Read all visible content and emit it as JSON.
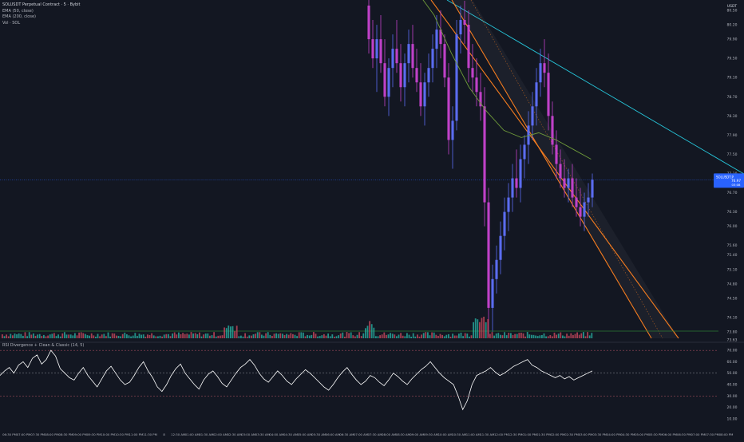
{
  "header": {
    "symbol_title": "SOLUSDT Perpetual Contract · 5 · Bybit",
    "ema50_label": "EMA (50, close)",
    "ema200_label": "EMA (200, close)",
    "vol_label": "Vol · SOL"
  },
  "currency": "USDT",
  "price_badge": {
    "symbol": "SOLUSDT.P",
    "price": "76.97",
    "countdown": "03:08"
  },
  "rsi_label": "RSI Divergence + Clean & Classic (14, 5)",
  "colors": {
    "background": "#131722",
    "bull": "#5b6cf0",
    "bear": "#c041c8",
    "ema50": "#6f9b3a",
    "channel": "#f57c1f",
    "trendline": "#26c6da",
    "rsi_line": "#ffffff",
    "last_price": "#2962ff"
  },
  "chart_data": [
    {
      "type": "candlestick",
      "title": "SOLUSDT Perpetual Contract · 5 · Bybit",
      "y_axis": {
        "unit": "USDT",
        "ticks": [
          "80.50",
          "80.20",
          "79.90",
          "79.50",
          "79.10",
          "78.70",
          "78.30",
          "77.90",
          "77.50",
          "77.10",
          "76.97",
          "76.70",
          "76.30",
          "76.00",
          "75.60",
          "75.40",
          "75.10",
          "74.80",
          "74.50",
          "74.10",
          "73.80",
          "73.63"
        ],
        "range": [
          73.6,
          80.65
        ]
      },
      "x_axis": {
        "ticks": [
          "06:30 PM",
          "07:00 PM",
          "07:30 PM",
          "08:00 PM",
          "08:30 PM",
          "09:00 PM",
          "09:30 PM",
          "10:00 PM",
          "10:30 PM",
          "11:00 PM",
          "11:30 PM",
          "8",
          "12:30 AM",
          "01:00 AM",
          "01:30 AM",
          "02:00 AM",
          "02:30 AM",
          "03:00 AM",
          "03:30 AM",
          "04:00 AM",
          "04:30 AM",
          "05:00 AM",
          "05:30 AM",
          "06:00 AM",
          "06:30 AM",
          "07:00 AM",
          "07:30 AM",
          "08:00 AM",
          "08:30 AM",
          "09:00 AM",
          "09:30 AM",
          "10:00 AM",
          "10:30 AM",
          "11:00 AM",
          "11:30 AM",
          "12:00 PM",
          "12:30 PM",
          "01:00 PM",
          "01:30 PM",
          "02:00 PM",
          "02:30 PM",
          "03:00 PM",
          "03:30 PM",
          "04:00 PM",
          "04:30 PM",
          "05:00 PM",
          "05:30 PM",
          "06:00 PM",
          "06:30 PM",
          "07:00 PM",
          "07:30 PM",
          "08:00 PM"
        ]
      },
      "series": [
        {
          "name": "EMA (50, close)",
          "values": [
            80.9,
            80.4,
            79.6,
            78.9,
            78.4,
            78.0,
            77.85,
            77.95,
            77.8,
            77.6,
            77.4
          ]
        },
        {
          "name": "EMA (200, close)",
          "values": []
        }
      ],
      "ohlc": [
        [
          80.6,
          80.9,
          79.6,
          79.9
        ],
        [
          79.9,
          80.3,
          79.3,
          79.5
        ],
        [
          79.5,
          80.2,
          78.8,
          79.9
        ],
        [
          79.9,
          80.4,
          79.2,
          79.4
        ],
        [
          79.4,
          79.9,
          78.5,
          78.7
        ],
        [
          78.7,
          79.5,
          78.3,
          79.3
        ],
        [
          79.3,
          80.0,
          78.9,
          79.7
        ],
        [
          79.7,
          80.3,
          79.2,
          79.4
        ],
        [
          79.4,
          79.8,
          78.6,
          78.9
        ],
        [
          78.9,
          79.6,
          78.5,
          79.4
        ],
        [
          79.4,
          80.1,
          79.0,
          79.8
        ],
        [
          79.8,
          80.2,
          79.1,
          79.3
        ],
        [
          79.3,
          79.7,
          78.8,
          79.0
        ],
        [
          79.0,
          79.4,
          78.3,
          78.5
        ],
        [
          78.5,
          79.2,
          78.1,
          79.0
        ],
        [
          79.0,
          79.6,
          78.7,
          79.3
        ],
        [
          79.3,
          80.0,
          79.0,
          79.7
        ],
        [
          79.7,
          80.4,
          79.3,
          80.1
        ],
        [
          80.1,
          80.5,
          79.5,
          79.8
        ],
        [
          79.8,
          80.0,
          78.9,
          79.1
        ],
        [
          79.1,
          79.4,
          77.5,
          77.8
        ],
        [
          77.8,
          78.5,
          77.2,
          78.2
        ],
        [
          78.2,
          80.3,
          78.0,
          80.0
        ],
        [
          80.0,
          80.6,
          79.6,
          80.3
        ],
        [
          80.3,
          80.7,
          79.8,
          80.2
        ],
        [
          80.2,
          80.5,
          79.0,
          79.3
        ],
        [
          79.3,
          79.8,
          78.8,
          79.1
        ],
        [
          79.1,
          79.5,
          78.5,
          78.8
        ],
        [
          78.8,
          79.2,
          78.2,
          78.5
        ],
        [
          78.5,
          78.9,
          76.0,
          76.5
        ],
        [
          76.5,
          76.8,
          73.7,
          74.3
        ],
        [
          74.3,
          75.2,
          73.8,
          74.9
        ],
        [
          74.9,
          75.6,
          74.6,
          75.3
        ],
        [
          75.3,
          76.1,
          75.0,
          75.8
        ],
        [
          75.8,
          76.6,
          75.5,
          76.3
        ],
        [
          76.3,
          76.9,
          75.9,
          76.6
        ],
        [
          76.6,
          77.3,
          76.3,
          77.0
        ],
        [
          77.0,
          77.6,
          76.6,
          76.8
        ],
        [
          76.8,
          77.7,
          76.5,
          77.4
        ],
        [
          77.4,
          77.9,
          77.0,
          77.7
        ],
        [
          77.7,
          78.4,
          77.3,
          78.1
        ],
        [
          78.1,
          78.8,
          77.8,
          78.5
        ],
        [
          78.5,
          79.3,
          78.1,
          79.0
        ],
        [
          79.0,
          79.7,
          78.7,
          79.4
        ],
        [
          79.4,
          79.9,
          78.9,
          79.2
        ],
        [
          79.2,
          79.6,
          78.0,
          78.3
        ],
        [
          78.3,
          78.6,
          77.5,
          77.7
        ],
        [
          77.7,
          78.0,
          77.0,
          77.3
        ],
        [
          77.3,
          77.6,
          76.8,
          77.0
        ],
        [
          77.0,
          77.4,
          76.6,
          76.8
        ],
        [
          76.8,
          77.2,
          76.5,
          77.0
        ],
        [
          77.0,
          77.3,
          76.4,
          76.6
        ],
        [
          76.6,
          77.0,
          76.2,
          76.4
        ],
        [
          76.4,
          76.8,
          76.0,
          76.2
        ],
        [
          76.2,
          76.7,
          75.9,
          76.5
        ],
        [
          76.5,
          76.9,
          76.2,
          76.6
        ],
        [
          76.6,
          77.1,
          76.4,
          76.97
        ]
      ]
    },
    {
      "type": "line",
      "title": "RSI Divergence + Clean & Classic (14, 5)",
      "y_axis": {
        "ticks": [
          "70.00",
          "60.00",
          "50.00",
          "40.00",
          "30.00",
          "20.00",
          "10.00"
        ],
        "range": [
          5,
          75
        ]
      },
      "series": [
        {
          "name": "RSI",
          "values": [
            48,
            52,
            55,
            50,
            57,
            60,
            55,
            63,
            66,
            58,
            62,
            70,
            65,
            54,
            50,
            46,
            44,
            50,
            55,
            48,
            43,
            38,
            45,
            52,
            56,
            50,
            44,
            40,
            42,
            48,
            55,
            60,
            52,
            46,
            38,
            34,
            40,
            48,
            54,
            58,
            50,
            45,
            40,
            36,
            44,
            49,
            52,
            47,
            41,
            38,
            44,
            50,
            55,
            58,
            62,
            57,
            50,
            45,
            42,
            47,
            52,
            48,
            43,
            40,
            45,
            49,
            53,
            50,
            46,
            42,
            38,
            35,
            40,
            46,
            51,
            55,
            49,
            44,
            40,
            43,
            48,
            46,
            42,
            39,
            44,
            50,
            47,
            43,
            40,
            45,
            49,
            53,
            56,
            60,
            55,
            50,
            46,
            43,
            40,
            30,
            18,
            26,
            40,
            48,
            50,
            52,
            55,
            51,
            48,
            50,
            53,
            56,
            58,
            60,
            62,
            57,
            55,
            52,
            50,
            48,
            46,
            48,
            45,
            47,
            44,
            46,
            48,
            50,
            52
          ]
        }
      ]
    },
    {
      "type": "bar",
      "title": "Vol · SOL",
      "series": [
        {
          "name": "Vol",
          "values": []
        }
      ]
    }
  ]
}
